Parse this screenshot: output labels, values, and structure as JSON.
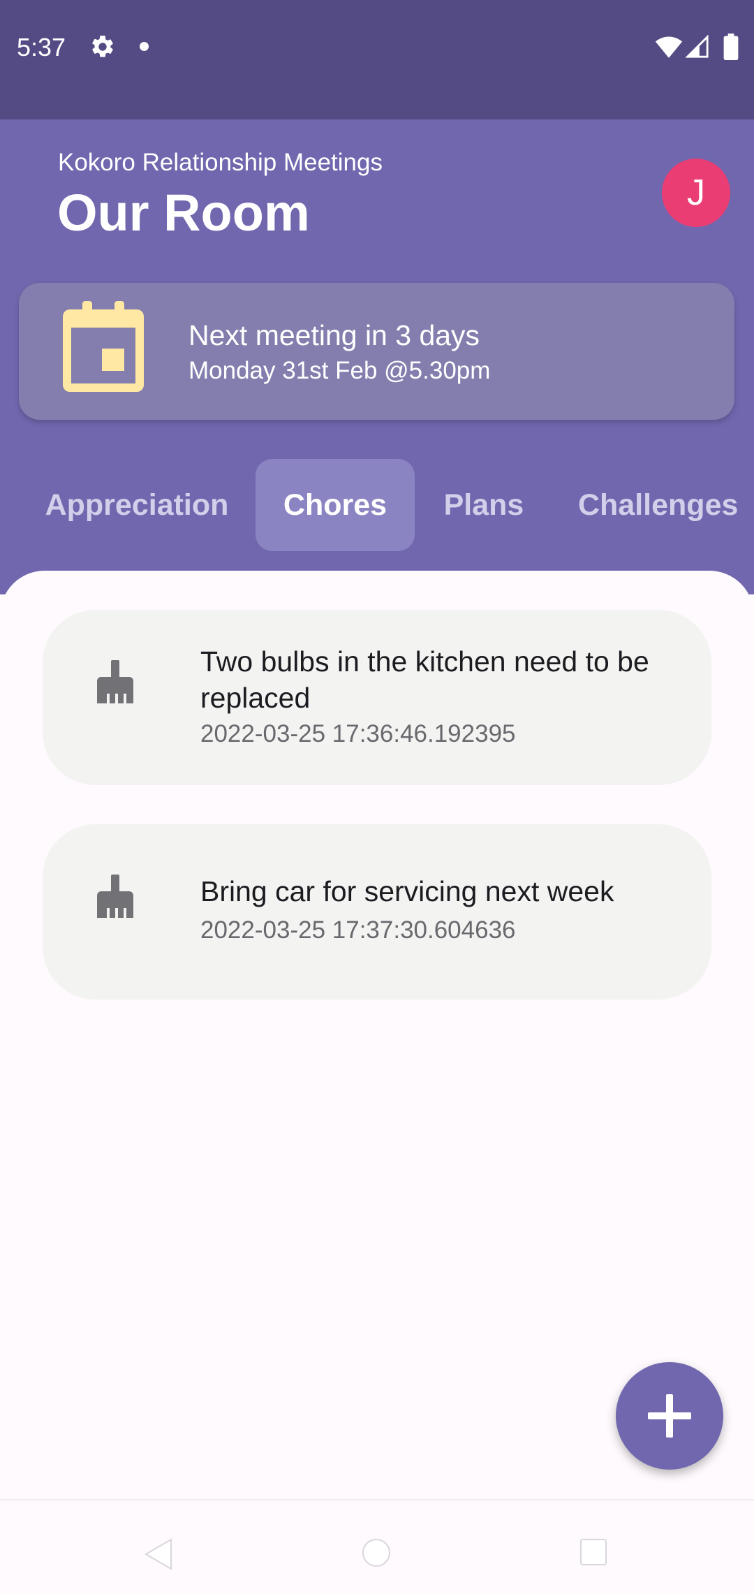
{
  "status_bar": {
    "time": "5:37",
    "icons": [
      "gear-icon",
      "notification-dot-icon",
      "wifi-icon",
      "signal-icon",
      "battery-icon"
    ]
  },
  "header": {
    "subtitle": "Kokoro Relationship Meetings",
    "title": "Our Room",
    "avatar_initial": "J"
  },
  "meeting": {
    "title": "Next meeting in 3 days",
    "date": "Monday 31st Feb @5.30pm",
    "icon": "calendar-icon"
  },
  "tabs": [
    {
      "label": "Appreciation",
      "active": false
    },
    {
      "label": "Chores",
      "active": true
    },
    {
      "label": "Plans",
      "active": false
    },
    {
      "label": "Challenges",
      "active": false
    }
  ],
  "chores": [
    {
      "text": "Two bulbs in the kitchen need to be replaced",
      "timestamp": "2022-03-25 17:36:46.192395",
      "icon": "broom-icon"
    },
    {
      "text": "Bring car for servicing next week",
      "timestamp": "2022-03-25 17:37:30.604636",
      "icon": "broom-icon"
    }
  ],
  "fab": {
    "icon": "plus-icon"
  },
  "nav_bar": {
    "icons": [
      "back-icon",
      "home-icon",
      "recents-icon"
    ]
  },
  "colors": {
    "status_bar": "#544b84",
    "header": "#7067ae",
    "meeting_card": "#837ead",
    "active_tab": "#8b84c2",
    "avatar": "#e93d73",
    "calendar": "#ffe8a3",
    "card": "#f3f3f2",
    "background": "#fefafd"
  }
}
